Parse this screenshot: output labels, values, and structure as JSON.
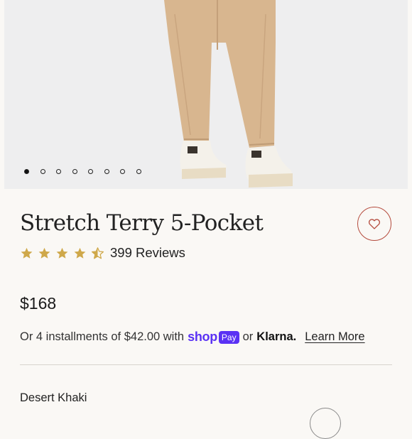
{
  "product": {
    "title": "Stretch Terry 5-Pocket",
    "rating": {
      "stars": 4.5,
      "max": 5,
      "reviews_label": "399 Reviews"
    },
    "price": "$168",
    "color_name": "Desert Khaki"
  },
  "gallery": {
    "image_count": 8,
    "active_index": 0
  },
  "installments": {
    "prefix": "Or 4 installments of $42.00 with",
    "shop_word": "shop",
    "pay_badge": "Pay",
    "or_text": "or",
    "klarna_text": "Klarna.",
    "learn_more": "Learn More"
  },
  "icons": {
    "wishlist": "heart-icon",
    "star": "star-icon"
  },
  "colors": {
    "accent_heart": "#b44a3c",
    "star": "#cfa84a",
    "shop_pay": "#5a31f4",
    "pants": "#d8b68f",
    "background": "#faf8f5"
  }
}
